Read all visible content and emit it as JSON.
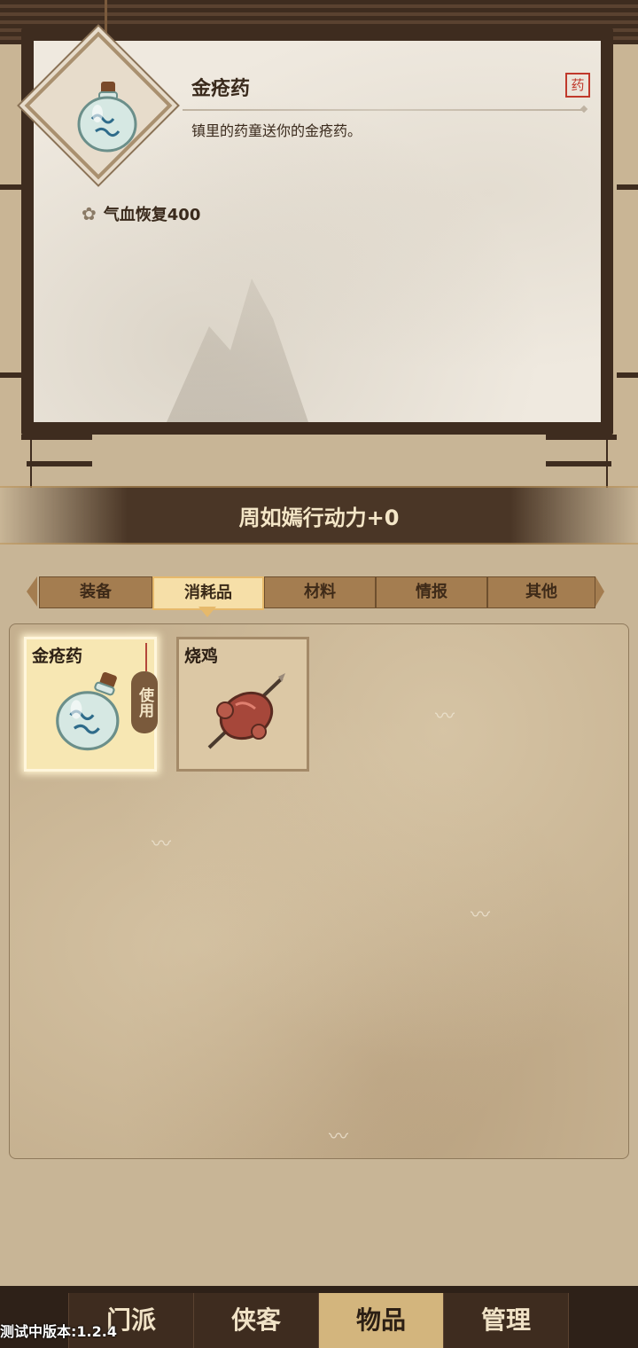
{
  "detail": {
    "item_name": "金疮药",
    "type_stamp": "药",
    "description": "镇里的药童送你的金疮药。",
    "effect": "气血恢复400",
    "effect_icon": "flower-icon",
    "item_icon": "medicine-bottle-icon"
  },
  "action_banner": {
    "text": "周如嫣行动力+0"
  },
  "tabs": [
    {
      "label": "装备",
      "active": false
    },
    {
      "label": "消耗品",
      "active": true
    },
    {
      "label": "材料",
      "active": false
    },
    {
      "label": "情报",
      "active": false
    },
    {
      "label": "其他",
      "active": false
    }
  ],
  "inventory": [
    {
      "name": "金疮药",
      "icon": "medicine-bottle-icon",
      "selected": true,
      "use_label": "使用"
    },
    {
      "name": "烧鸡",
      "icon": "roast-chicken-icon",
      "selected": false
    }
  ],
  "bottom_nav": [
    {
      "label": "门派",
      "active": false
    },
    {
      "label": "侠客",
      "active": false
    },
    {
      "label": "物品",
      "active": true
    },
    {
      "label": "管理",
      "active": false
    }
  ],
  "version": "测试中版本:1.2.4",
  "colors": {
    "frame_dark": "#3e2c1f",
    "tab_active": "#f6dfa8",
    "stamp_red": "#c0392b",
    "nav_active": "#d3b57d"
  }
}
